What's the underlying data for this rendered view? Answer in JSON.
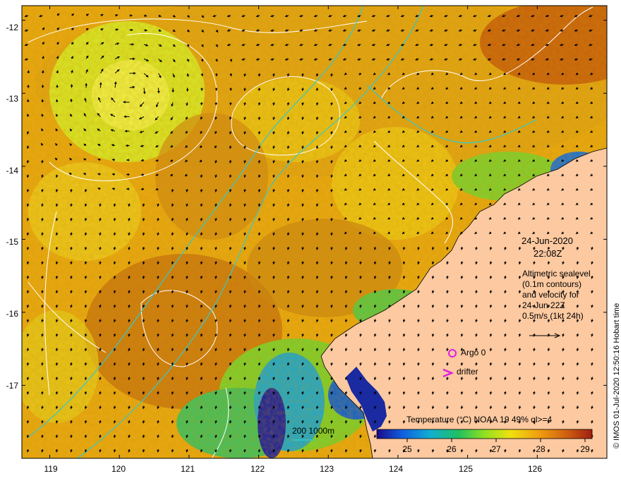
{
  "map": {
    "lat_ticks": [
      "-12",
      "-13",
      "-14",
      "-15",
      "-16",
      "-17"
    ],
    "lon_ticks": [
      "119",
      "120",
      "121",
      "122",
      "123",
      "124",
      "125",
      "126"
    ],
    "extent": {
      "lon_min": 118.6,
      "lon_max": 127.0,
      "lat_min": -18.0,
      "lat_max": -11.8
    },
    "land_color": "#fcc9a0",
    "current_arrow_color": "#000000",
    "sea_level_contour_color": "#ffffff",
    "bathymetry_contour_color": "#35c9c9"
  },
  "annotations": {
    "date": "24-Jun-2020",
    "time": "22:08Z",
    "description_lines": [
      "Altimetric sealevel",
      "(0.1m contours)",
      "and velocity for",
      "24-Jun 22Z",
      "0.5m/s (1kt 24h)"
    ],
    "argo_label": "Argo 0",
    "drifter_label": "drifter",
    "argo_marker_color": "#e020e0",
    "drifter_marker_color": "#e020e0",
    "bathymetry_legend": "200  1000m"
  },
  "colorbar": {
    "title": "Temperature (°C) NOAA 19 49% ql>=4",
    "ticks": [
      "25",
      "26",
      "27",
      "28",
      "29"
    ],
    "colors": [
      "#1a0a8a",
      "#1060e0",
      "#10b0d0",
      "#20c060",
      "#90e020",
      "#f0e010",
      "#f0a010",
      "#d06010",
      "#a02010"
    ]
  },
  "credit": "© IMOS 01-Jul-2020 12:50:16 Hobart time"
}
